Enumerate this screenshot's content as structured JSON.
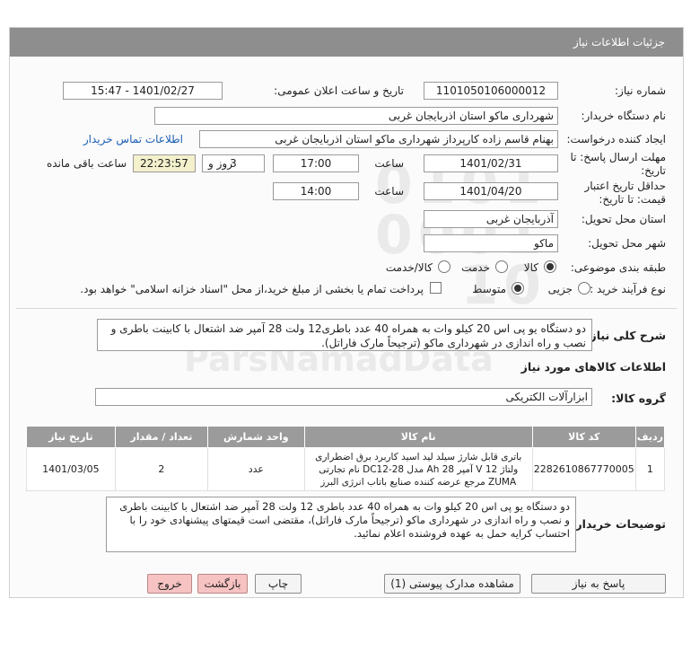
{
  "header": {
    "title": "جزئیات اطلاعات نیاز"
  },
  "form": {
    "need_number_label": "شماره نیاز:",
    "need_number": "1101050106000012",
    "announce_label": "تاریخ و ساعت اعلان عمومی:",
    "announce_value": "1401/02/27 - 15:47",
    "buyer_org_label": "نام دستگاه خریدار:",
    "buyer_org": "شهرداری ماکو استان اذربایجان غربی",
    "creator_label": "ایجاد کننده درخواست:",
    "creator": "بهنام قاسم زاده کارپرداز شهرداری ماکو استان اذربایجان غربی",
    "contact_link": "اطلاعات تماس خریدار",
    "deadline_label_1": "مهلت ارسال پاسخ: تا",
    "deadline_label_2": "تاریخ:",
    "deadline_date": "1401/02/31",
    "time_label": "ساعت",
    "deadline_time": "17:00",
    "days_value": "3",
    "days_label": "روز و",
    "remaining_time": "22:23:57",
    "remaining_label": "ساعت باقی مانده",
    "validity_label_1": "حداقل تاریخ اعتبار",
    "validity_label_2": "قیمت: تا تاریخ:",
    "validity_date": "1401/04/20",
    "validity_time": "14:00",
    "province_label": "استان محل تحویل:",
    "province": "آذربایجان غربی",
    "city_label": "شهر محل تحویل:",
    "city": "ماکو",
    "category_label": "طبقه بندی موضوعی:",
    "category_options": [
      "کالا",
      "خدمت",
      "کالا/خدمت"
    ],
    "category_selected": "کالا",
    "process_label": "نوع فرآیند خرید :",
    "process_options": [
      "جزیی",
      "متوسط"
    ],
    "process_selected": "متوسط",
    "payment_note": "پرداخت تمام یا بخشی از مبلغ خرید،از محل \"اسناد خزانه اسلامی\" خواهد بود."
  },
  "summary": {
    "label": "شرح کلی نیاز:",
    "text": "دو دستگاه یو پی اس 20 کیلو وات به همراه 40 عدد باطری12 ولت 28 آمپر ضد اشتعال با کابینت باطری و نصب و راه اندازی در شهرداری ماکو (ترجیحاً مارک فاراتل)."
  },
  "goods": {
    "section_title": "اطلاعات کالاهای مورد نیاز",
    "group_label": "گروه کالا:",
    "group_value": "ابزارآلات الکتریکی",
    "columns": [
      "ردیف",
      "کد کالا",
      "نام کالا",
      "واحد شمارش",
      "تعداد / مقدار",
      "تاریخ نیاز"
    ],
    "rows": [
      {
        "index": "1",
        "code": "2282610867770005",
        "name": "باتری قابل شارژ سیلد لید اسید کاربرد برق اضطراری ولتاژ 12 V آمپر 28 Ah مدل DC12-28 نام تجارتی ZUMA مرجع عرضه کننده صنایع باتاب انرژی البرز",
        "unit": "عدد",
        "qty": "2",
        "date": "1401/03/05"
      }
    ]
  },
  "buyer_notes": {
    "label": "توضیحات خریدار:",
    "text": "دو دستگاه یو پی اس 20 کیلو وات به همراه 40 عدد باطری 12 ولت 28 آمپر ضد اشتعال با کابینت باطری و نصب و راه اندازی در شهرداری ماکو (ترجیحاً مارک فاراتل)، مقتضی است قیمتهای پیشنهادی خود را با احتساب کرایه حمل به عهده فروشنده اعلام نمائید."
  },
  "buttons": {
    "reply": "پاسخ به نیاز",
    "view_docs": "مشاهده مدارک پیوستی (1)",
    "print": "چاپ",
    "back": "بازگشت",
    "exit": "خروج"
  },
  "colors": {
    "title_bar": "#8e8e8e",
    "table_header": "#9b9b9b",
    "remaining_box": "#f3f0cc",
    "danger_button": "#f7c2c2",
    "link": "#1a5fb4"
  }
}
